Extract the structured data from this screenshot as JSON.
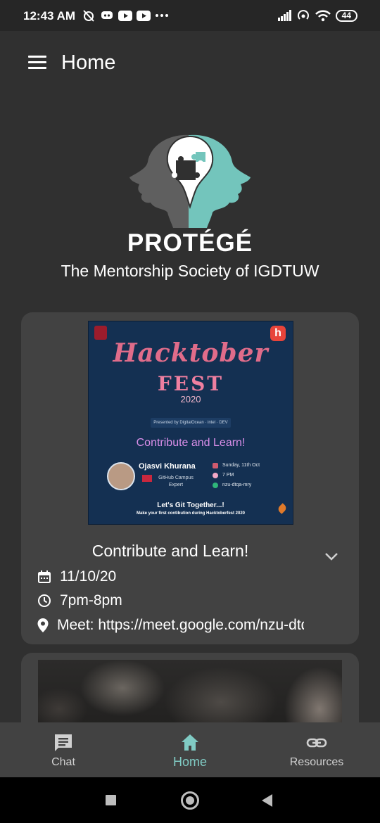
{
  "status_bar": {
    "time": "12:43 AM",
    "battery": "44",
    "icons": [
      "alarm-off-icon",
      "discord-icon",
      "youtube-icon",
      "youtube-icon",
      "more-dots-icon",
      "signal-icon",
      "hotspot-icon",
      "wifi-icon",
      "battery-icon"
    ]
  },
  "app_bar": {
    "title": "Home",
    "menu_icon": "hamburger-menu-icon"
  },
  "brand": {
    "title": "PROTÉGÉ",
    "subtitle": "The Mentorship Society of IGDTUW",
    "colors": {
      "left_head": "#5f5f5f",
      "right_head": "#73c5bc",
      "bulb": "#ffffff"
    }
  },
  "events": [
    {
      "poster": {
        "heading": "Hacktober",
        "fest": "FEST",
        "year": "2020",
        "sponsor_line": "Presented by  DigitalOcean  ·  intel  ·  DEV",
        "tagline": "Contribute and Learn!",
        "speaker_name": "Ojasvi Khurana",
        "speaker_role": "GitHub Campus Expert",
        "date_line": "Sunday, 11th Oct",
        "time_line": "7 PM",
        "code_line": "nzu-dtqa-mry",
        "cta": "Let's Git Together...!",
        "cta_sub": "Make your first contibution during Hacktoberfest 2020",
        "brand_badge": "h"
      },
      "title": "Contribute and Learn!",
      "date": "11/10/20",
      "time": "7pm-8pm",
      "link": "Meet: https://meet.google.com/nzu-dtqa-mry",
      "icons": {
        "date": "calendar-icon",
        "time": "clock-icon",
        "link": "location-pin-icon",
        "expand": "chevron-down-icon"
      }
    }
  ],
  "bottom_nav": {
    "items": [
      {
        "label": "Chat",
        "icon": "chat-icon",
        "active": false
      },
      {
        "label": "Home",
        "icon": "home-icon",
        "active": true
      },
      {
        "label": "Resources",
        "icon": "link-icon",
        "active": false
      }
    ],
    "active_color": "#80cbc4"
  },
  "system_nav": [
    "recents-square-icon",
    "home-circle-icon",
    "back-triangle-icon"
  ]
}
